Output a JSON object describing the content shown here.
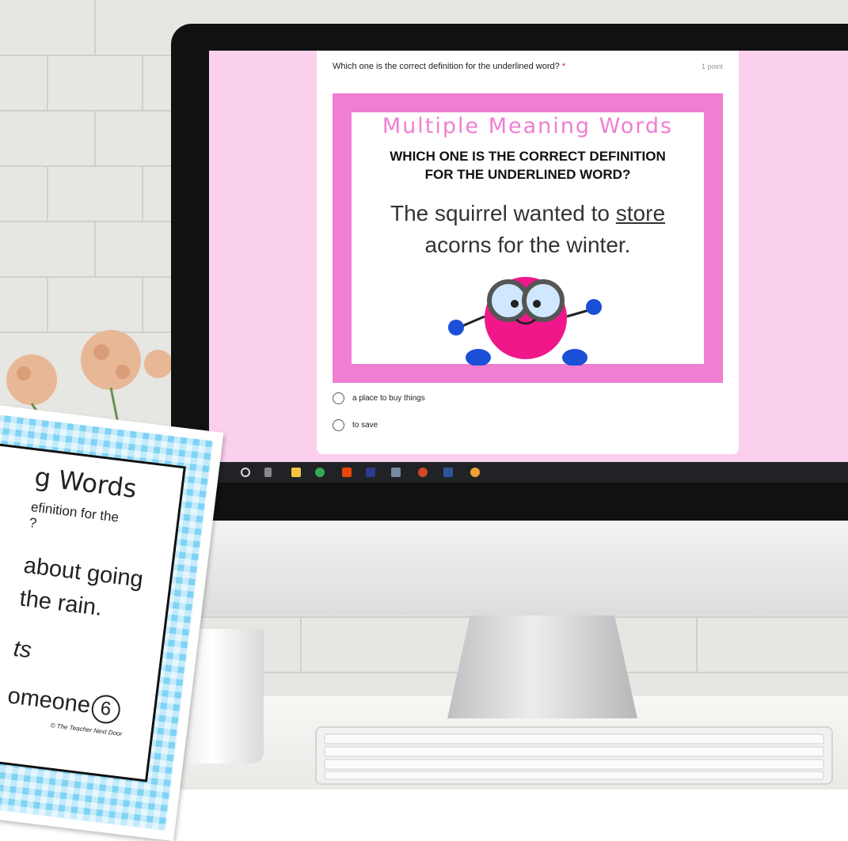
{
  "colors": {
    "pink_bg": "#fbd0ec",
    "card_pink": "#f07ed2",
    "plaid_blue": "#7fd3f5",
    "character": "#f0178a"
  },
  "form": {
    "question": "Which one is the correct definition for the underlined word?",
    "required_marker": "*",
    "points": "1 point",
    "options": [
      "a place to buy things",
      "to save"
    ]
  },
  "card": {
    "title": "Multiple Meaning Words",
    "subtitle_line1": "WHICH ONE IS THE CORRECT DEFINITION",
    "subtitle_line2": "FOR THE UNDERLINED WORD?",
    "sentence_part1": "The squirrel wanted to ",
    "sentence_underlined": "store",
    "sentence_line2": "acorns for the winter."
  },
  "paper": {
    "title": "g Words",
    "subtitle": "efinition for the",
    "subtitle2": "?",
    "line1": "about going",
    "line2": "the rain.",
    "line3": "ts",
    "line4": "omeone",
    "page_number": "6",
    "copyright": "© The Teacher Next Door"
  },
  "taskbar_icons": [
    "cortana-icon",
    "task-view-icon",
    "file-explorer-icon",
    "chrome-icon",
    "office-icon",
    "acrobat-icon",
    "app-icon",
    "powerpoint-icon",
    "word-icon",
    "paint-icon"
  ]
}
